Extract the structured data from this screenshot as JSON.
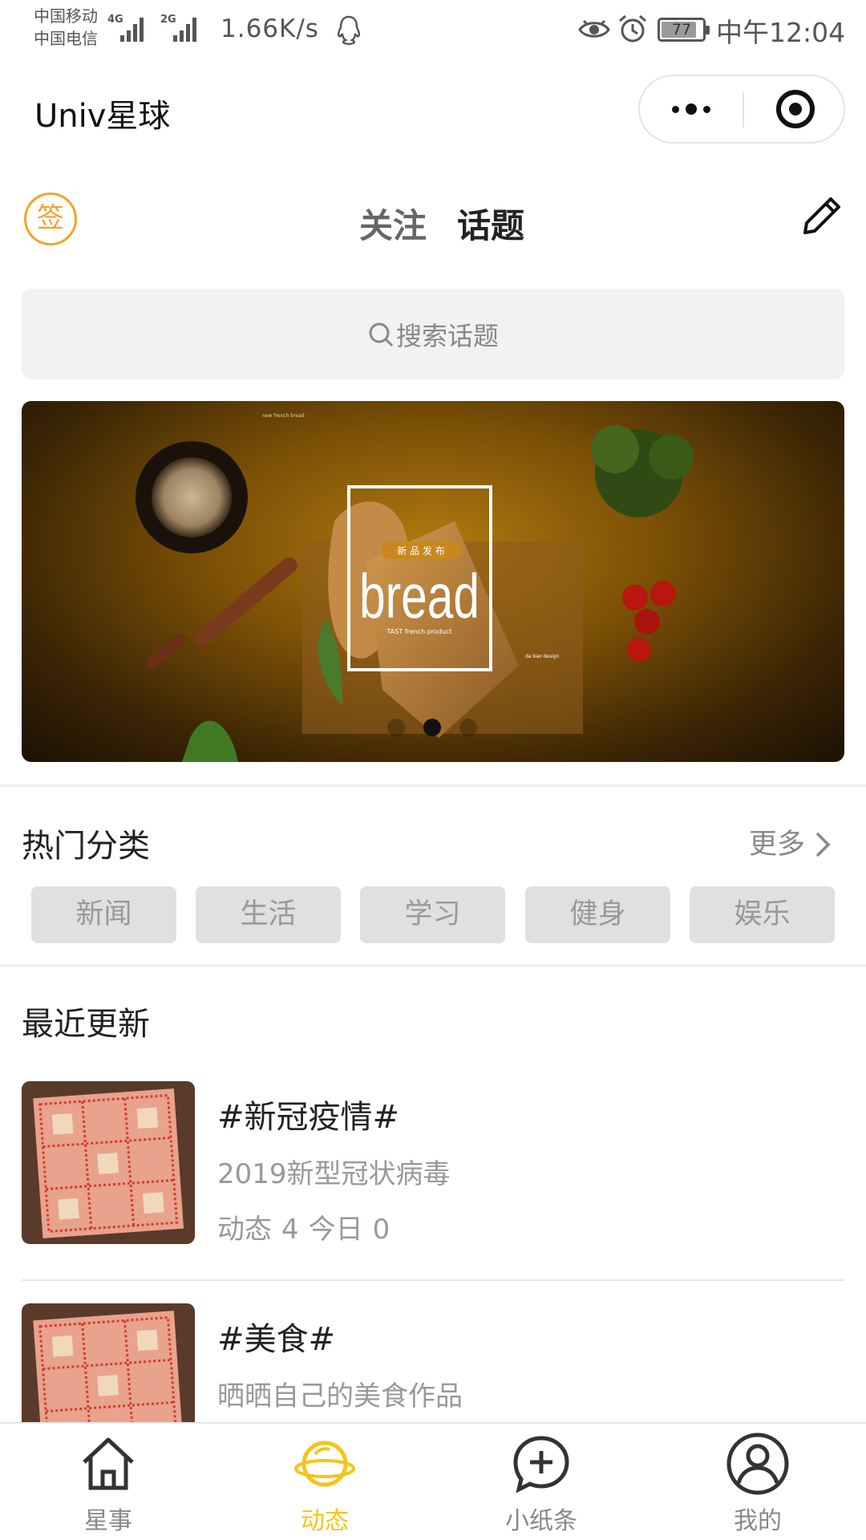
{
  "status_bar": {
    "carrier_1": "中国移动",
    "carrier_2": "中国电信",
    "sim1_type": "4G",
    "sim2_type": "2G",
    "net_speed": "1.66K/s",
    "battery": "77",
    "time": "中午12:04"
  },
  "titlebar": {
    "title": "Univ星球"
  },
  "topnav": {
    "sign_label": "签",
    "tabs": [
      {
        "label": "关注",
        "active": false
      },
      {
        "label": "话题",
        "active": true
      }
    ]
  },
  "search": {
    "placeholder": "搜索话题"
  },
  "banner": {
    "headline": "bread",
    "badge": "新 品 发 布",
    "tagline": "TAST french product",
    "small_text": "new french bread",
    "corner_text": "da bao design",
    "slide_count": 3,
    "active_slide": 2
  },
  "hot_categories": {
    "title": "热门分类",
    "more": "更多",
    "items": [
      "新闻",
      "生活",
      "学习",
      "健身",
      "娱乐"
    ]
  },
  "recent": {
    "title": "最近更新",
    "topics": [
      {
        "name": "#新冠疫情#",
        "desc": "2019新型冠状病毒",
        "posts_label": "动态",
        "posts": "4",
        "today_label": "今日",
        "today": "0"
      },
      {
        "name": "#美食#",
        "desc": "晒晒自己的美食作品"
      }
    ]
  },
  "tabbar": {
    "items": [
      {
        "label": "星事",
        "icon": "home-icon",
        "active": false
      },
      {
        "label": "动态",
        "icon": "planet-icon",
        "active": true
      },
      {
        "label": "小纸条",
        "icon": "add-circle-icon",
        "active": false
      },
      {
        "label": "我的",
        "icon": "user-icon",
        "active": false
      }
    ]
  },
  "colors": {
    "accent": "#f5c518",
    "sign": "#f3a32c",
    "muted": "#999999"
  }
}
